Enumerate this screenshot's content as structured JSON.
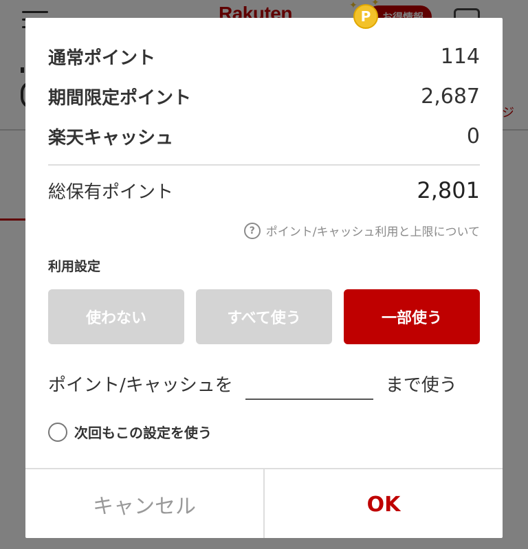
{
  "background": {
    "logo": "Rakuten",
    "deal_badge_coin": "P",
    "deal_badge_label": "お得情報"
  },
  "points": {
    "regular_label": "通常ポイント",
    "regular_value": "114",
    "limited_label": "期間限定ポイント",
    "limited_value": "2,687",
    "cash_label": "楽天キャッシュ",
    "cash_value": "0",
    "total_label": "総保有ポイント",
    "total_value": "2,801"
  },
  "help_link": "ポイント/キャッシュ利用と上限について",
  "usage": {
    "section_label": "利用設定",
    "options": [
      "使わない",
      "すべて使う",
      "一部使う"
    ],
    "selected": "一部使う"
  },
  "amount": {
    "prefix": "ポイント/キャッシュを",
    "value": "",
    "suffix": "まで使う"
  },
  "remember": {
    "label": "次回もこの設定を使う",
    "checked": false
  },
  "footer": {
    "cancel_label": "キャンセル",
    "ok_label": "OK"
  },
  "colors": {
    "accent": "#bf0000",
    "button_disabled": "#d4d4d4"
  }
}
